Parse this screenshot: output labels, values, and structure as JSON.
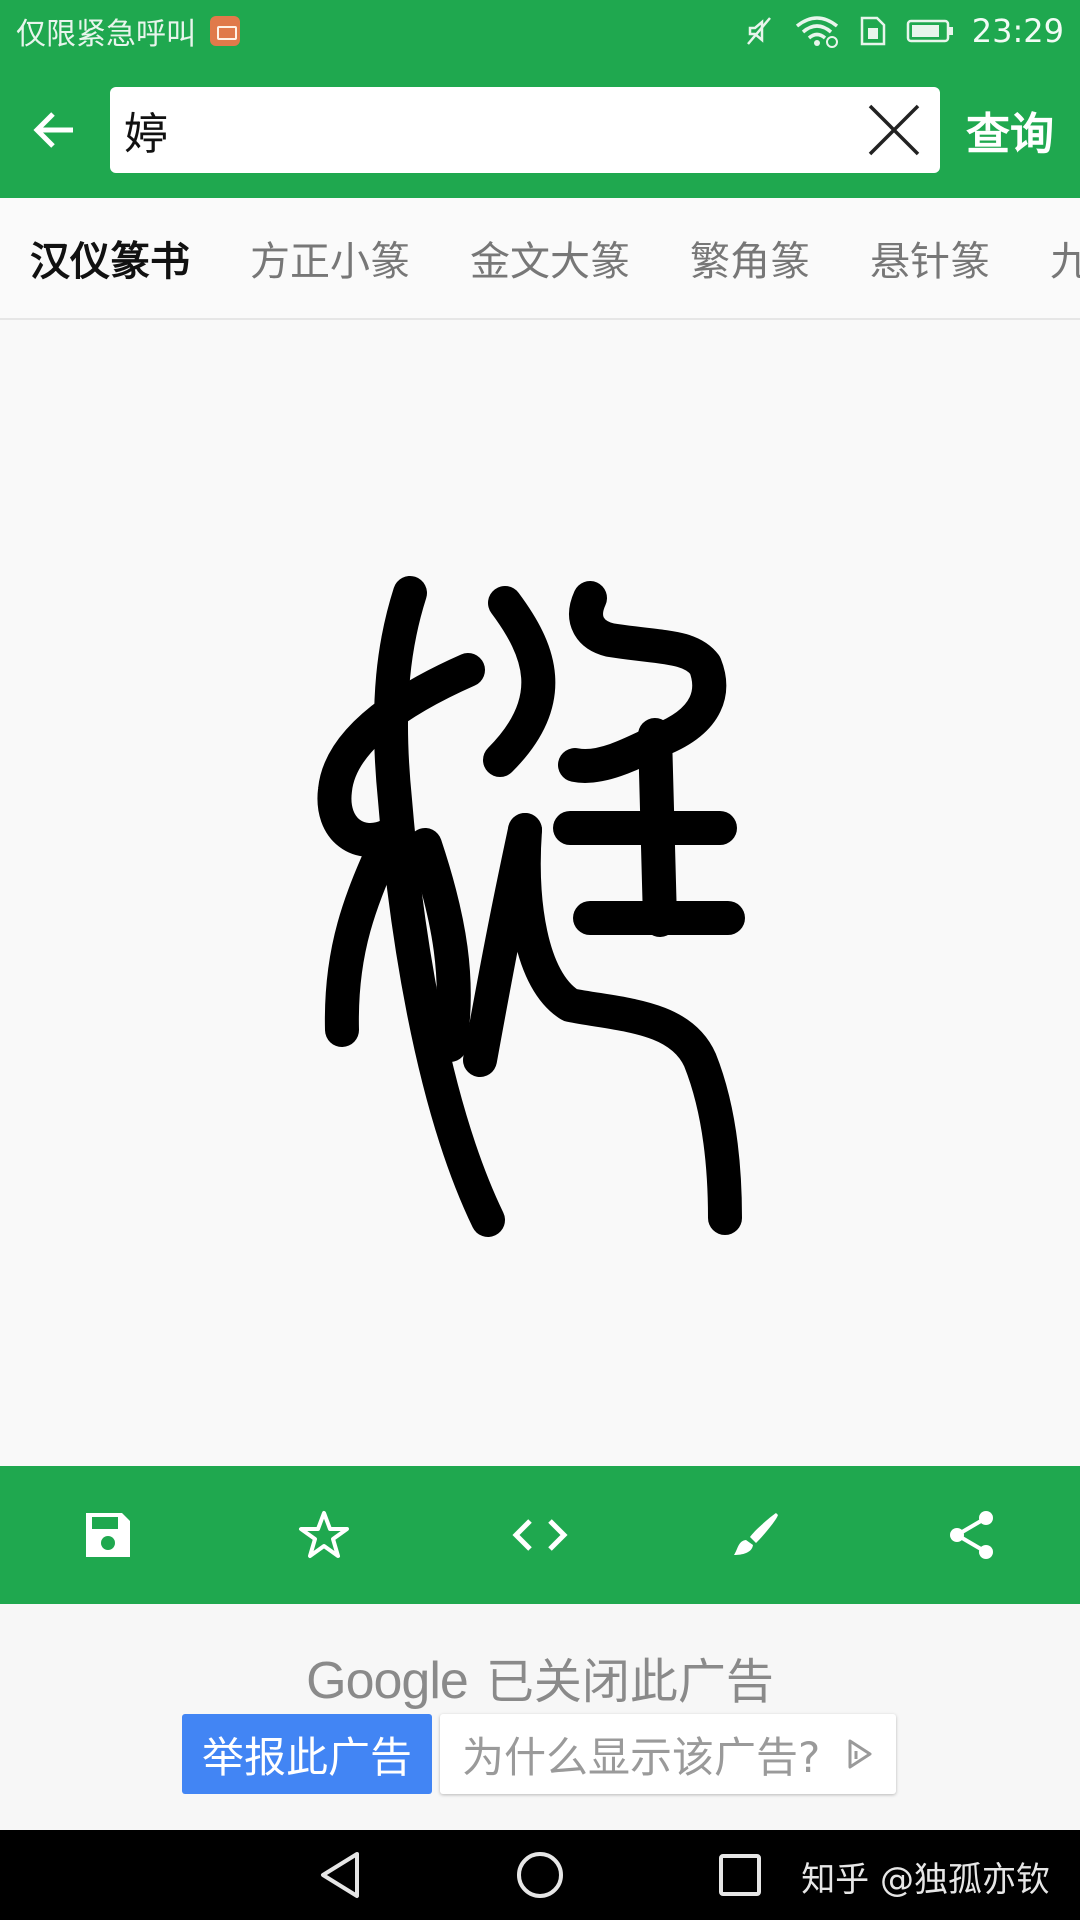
{
  "status_bar": {
    "carrier_text": "仅限紧急呼叫",
    "time": "23:29",
    "icons": [
      "notification-app-icon",
      "mute-icon",
      "wifi-icon",
      "sim-icon",
      "battery-icon"
    ]
  },
  "app_bar": {
    "back_icon": "arrow-left-icon",
    "search_value": "婷",
    "clear_icon": "close-icon",
    "query_label": "查询"
  },
  "tabs": [
    {
      "label": "汉仪篆书",
      "active": true
    },
    {
      "label": "方正小篆",
      "active": false
    },
    {
      "label": "金文大篆",
      "active": false
    },
    {
      "label": "繁角篆",
      "active": false
    },
    {
      "label": "悬针篆",
      "active": false
    },
    {
      "label": "九",
      "active": false
    }
  ],
  "glyph": {
    "character": "婷",
    "style": "汉仪篆书",
    "stroke_color": "#000000"
  },
  "actions": [
    {
      "name": "save",
      "icon": "save-icon"
    },
    {
      "name": "favorite",
      "icon": "star-icon"
    },
    {
      "name": "embed-code",
      "icon": "code-icon"
    },
    {
      "name": "brush",
      "icon": "brush-icon"
    },
    {
      "name": "share",
      "icon": "share-icon"
    }
  ],
  "ad": {
    "google_word": "Google",
    "closed_text": "已关闭此广告",
    "report_label": "举报此广告",
    "why_label": "为什么显示该广告?"
  },
  "nav_bar": {
    "buttons": [
      "back-triangle-icon",
      "home-circle-icon",
      "recents-square-icon"
    ],
    "watermark": "知乎 @独孤亦钦"
  },
  "colors": {
    "accent": "#1fa84f",
    "report_blue": "#4285f4"
  }
}
